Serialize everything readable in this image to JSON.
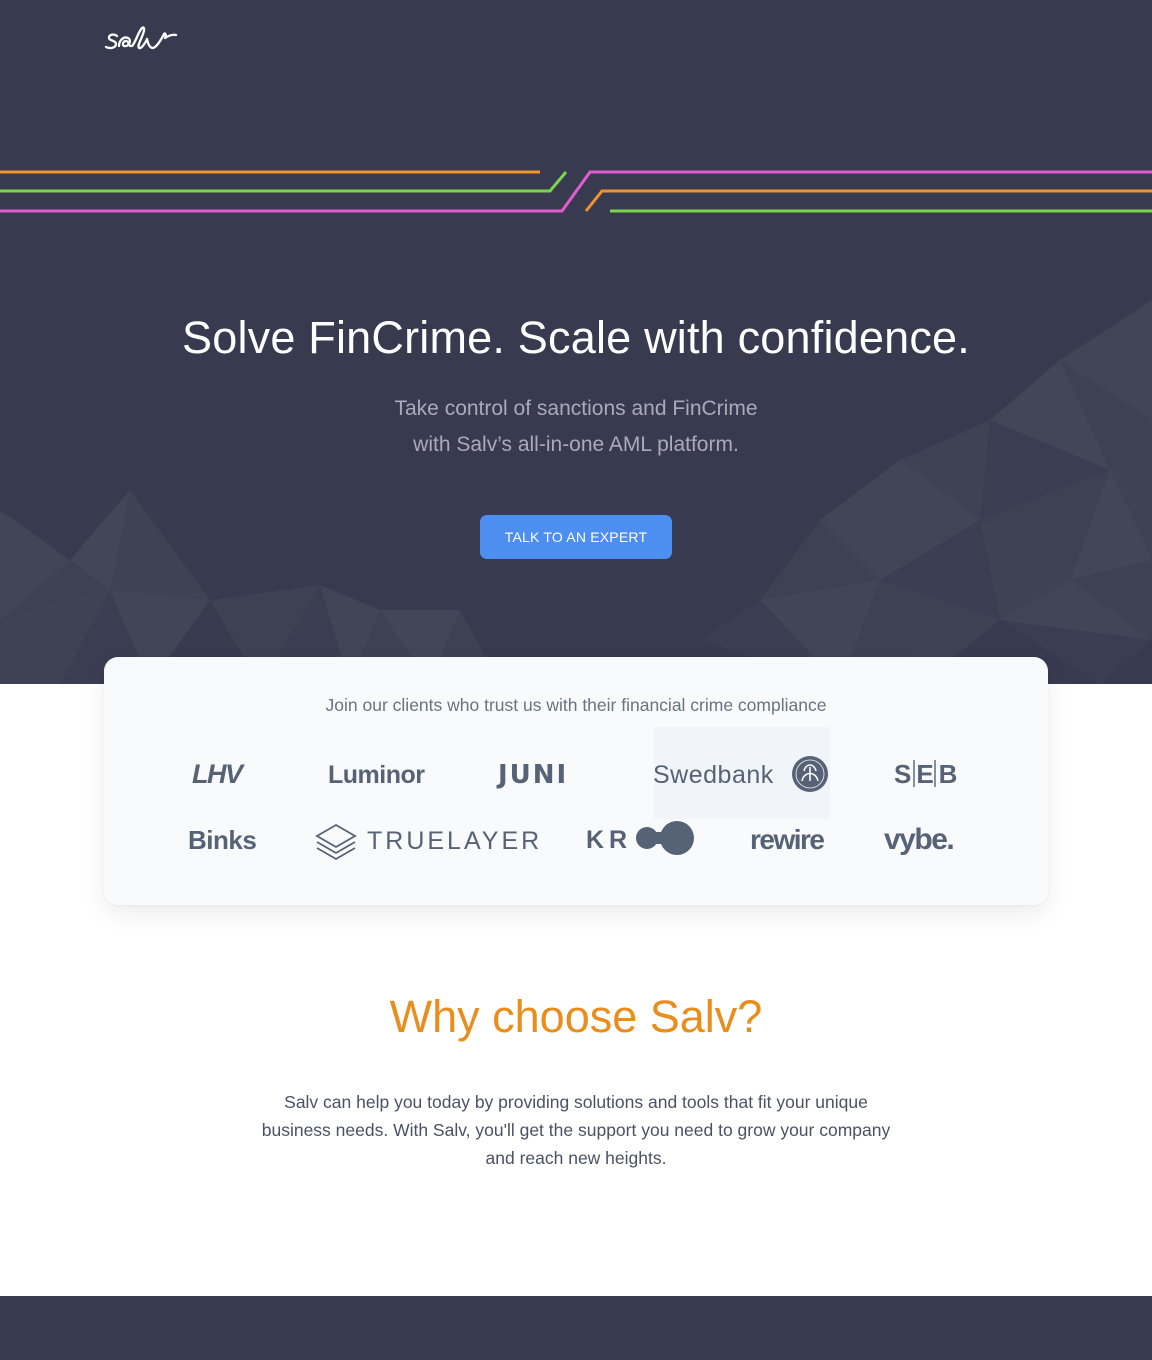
{
  "header": {
    "logo_text": "salv"
  },
  "hero": {
    "title": "Solve FinCrime. Scale with confidence.",
    "subtitle_line1": "Take control of sanctions and FinCrime",
    "subtitle_line2": "with Salv’s all-in-one AML platform.",
    "cta_label": "TALK TO AN EXPERT",
    "accent_colors": {
      "orange": "#f0932f",
      "green": "#7cd44a",
      "pink": "#e35bd1"
    }
  },
  "clients": {
    "heading": "Join our clients who trust us with their financial crime compliance",
    "logos": [
      "LHV",
      "Luminor",
      "JUNI",
      "Swedbank",
      "SEB",
      "Binks",
      "TRUELAYER",
      "KR",
      "rewire",
      "vybe."
    ]
  },
  "why": {
    "title": "Why choose Salv?",
    "body": "Salv can help you today by providing solutions and tools that fit your unique business needs. With Salv, you'll get the support you need to grow your company and reach new heights."
  },
  "colors": {
    "hero_bg": "#383a4f",
    "cta_bg": "#4c8ff1",
    "why_title": "#e98d1d",
    "logo_gray": "#566275"
  }
}
